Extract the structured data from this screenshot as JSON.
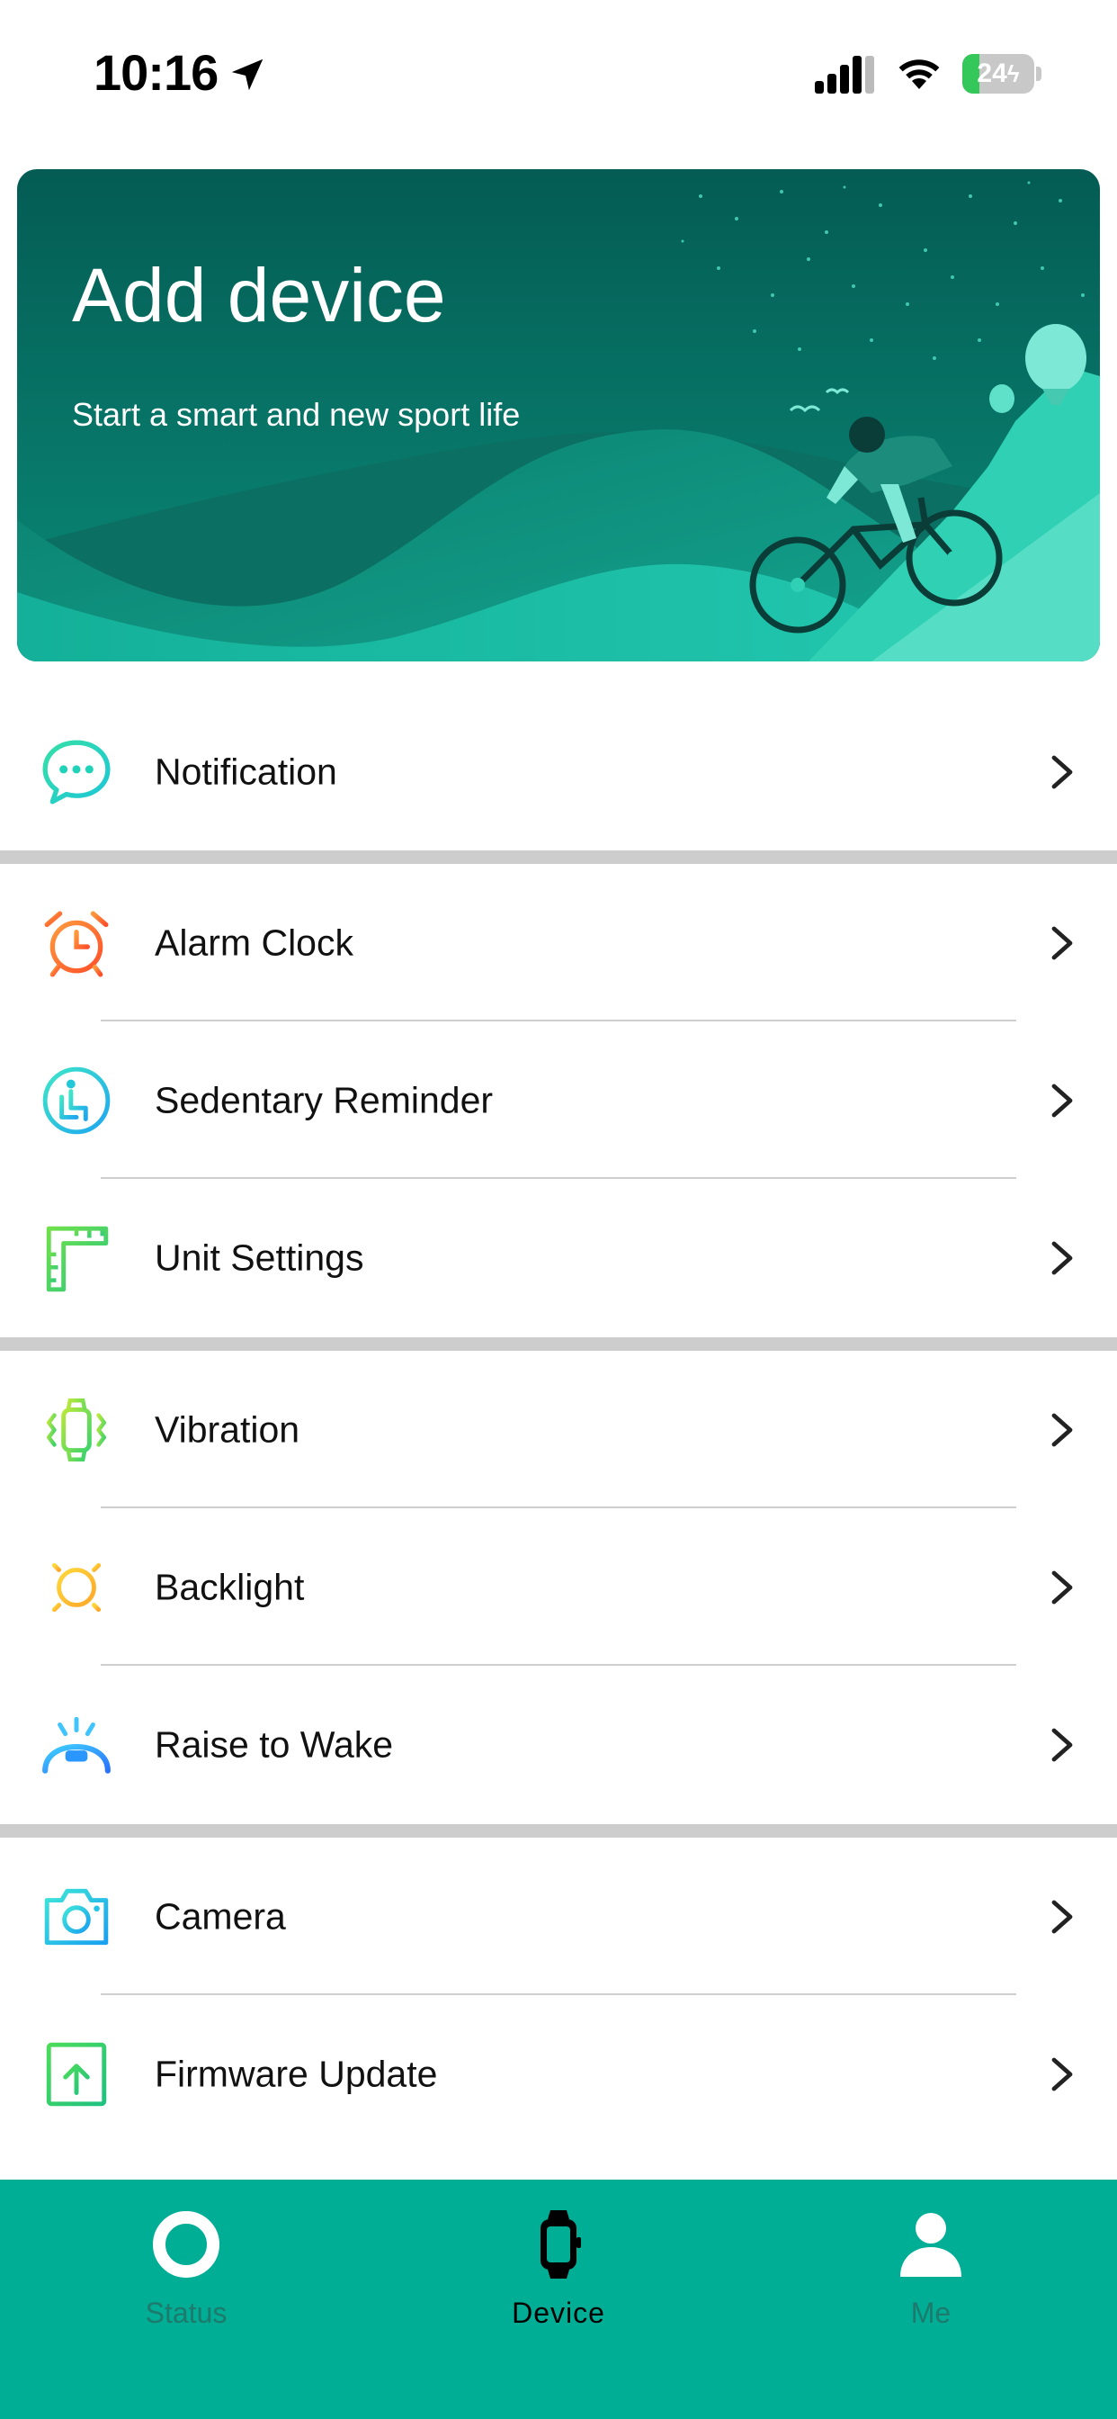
{
  "status_bar": {
    "time": "10:16",
    "battery_level": "24",
    "battery_fraction": 0.24,
    "icons": [
      "location-arrow-icon",
      "signal-icon",
      "wifi-icon",
      "battery-charging-icon"
    ]
  },
  "banner": {
    "title": "Add device",
    "subtitle": "Start a smart and new sport life"
  },
  "groups": [
    {
      "items": [
        {
          "label": "Notification",
          "icon": "chat-bubble-icon",
          "color": "#1ed3b8"
        }
      ]
    },
    {
      "items": [
        {
          "label": "Alarm Clock",
          "icon": "alarm-clock-icon",
          "color": "#ff6b2c"
        },
        {
          "label": "Sedentary Reminder",
          "icon": "sitting-person-icon",
          "color": "#22c8d8"
        },
        {
          "label": "Unit Settings",
          "icon": "ruler-icon",
          "color": "#4ccf5a"
        }
      ]
    },
    {
      "items": [
        {
          "label": "Vibration",
          "icon": "watch-vibration-icon",
          "color": "#7fdc3a"
        },
        {
          "label": "Backlight",
          "icon": "sun-icon",
          "color": "#ffc928"
        },
        {
          "label": "Raise to Wake",
          "icon": "raise-wrist-icon",
          "color": "#2a96ff"
        }
      ]
    },
    {
      "items": [
        {
          "label": "Camera",
          "icon": "camera-icon",
          "color": "#22c4e8"
        },
        {
          "label": "Firmware Update",
          "icon": "upload-icon",
          "color": "#35d35a"
        }
      ]
    }
  ],
  "tabs": [
    {
      "label": "Status",
      "icon": "ring-icon",
      "active": false
    },
    {
      "label": "Device",
      "icon": "watch-icon",
      "active": true
    },
    {
      "label": "Me",
      "icon": "person-icon",
      "active": false
    }
  ],
  "colors": {
    "accent": "#00ae95",
    "banner_dark": "#005f57",
    "separator": "#cdcdcd"
  }
}
